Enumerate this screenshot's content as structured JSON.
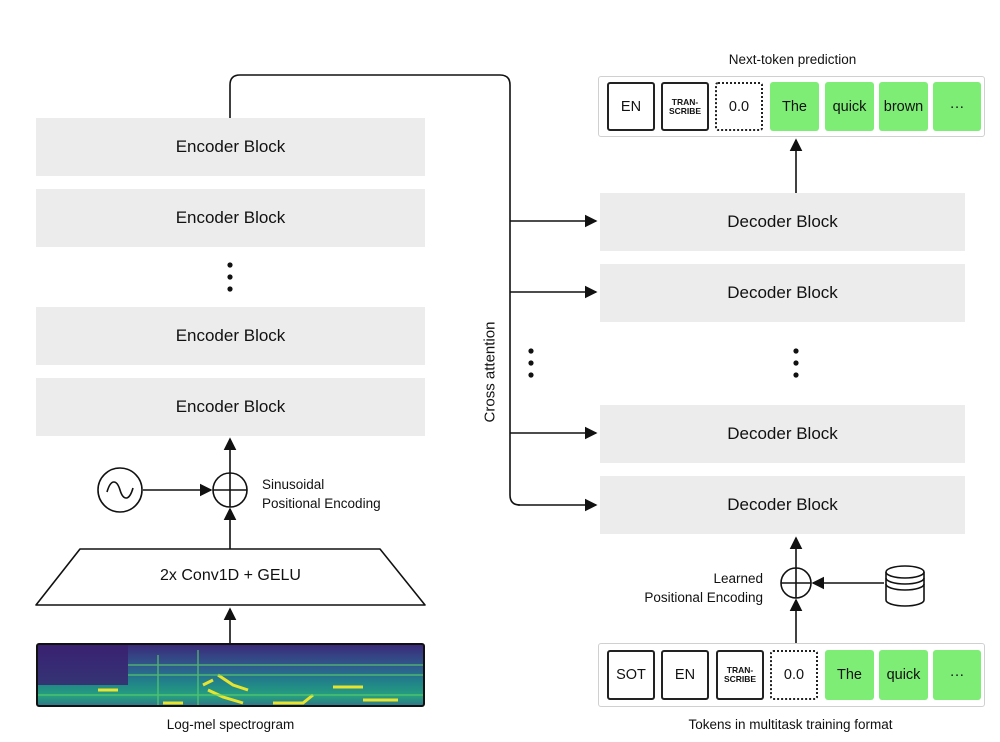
{
  "encoder": {
    "blocks": [
      "Encoder Block",
      "Encoder Block",
      "Encoder Block",
      "Encoder Block"
    ],
    "conv_label": "2x Conv1D + GELU",
    "positional_label_1": "Sinusoidal",
    "positional_label_2": "Positional Encoding",
    "input_caption": "Log-mel spectrogram"
  },
  "cross_attention_label": "Cross attention",
  "decoder": {
    "blocks": [
      "Decoder Block",
      "Decoder Block",
      "Decoder Block",
      "Decoder Block"
    ],
    "positional_label_1": "Learned",
    "positional_label_2": "Positional Encoding"
  },
  "output": {
    "title": "Next-token prediction",
    "tokens": [
      {
        "text": "EN",
        "kind": "special"
      },
      {
        "text": "TRAN-\nSCRIBE",
        "kind": "special"
      },
      {
        "text": "0.0",
        "kind": "timestamp"
      },
      {
        "text": "The",
        "kind": "text"
      },
      {
        "text": "quick",
        "kind": "text"
      },
      {
        "text": "brown",
        "kind": "text"
      },
      {
        "text": "···",
        "kind": "text"
      }
    ]
  },
  "input_tokens": {
    "caption": "Tokens in multitask training format",
    "tokens": [
      {
        "text": "SOT",
        "kind": "special"
      },
      {
        "text": "EN",
        "kind": "special"
      },
      {
        "text": "TRAN-\nSCRIBE",
        "kind": "special"
      },
      {
        "text": "0.0",
        "kind": "timestamp"
      },
      {
        "text": "The",
        "kind": "text"
      },
      {
        "text": "quick",
        "kind": "text"
      },
      {
        "text": "···",
        "kind": "text"
      }
    ]
  },
  "colors": {
    "block": "#ececec",
    "text_token": "#7eed76",
    "line": "#111111"
  }
}
